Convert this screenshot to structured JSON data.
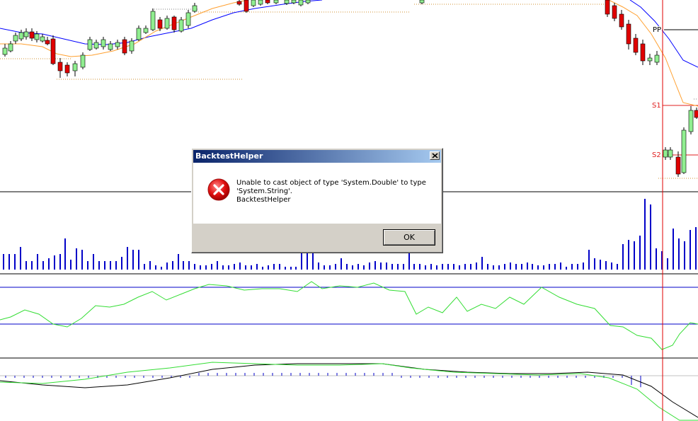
{
  "chart": {
    "pivot_labels": {
      "pp": "PP",
      "s1": "S1",
      "s2": "S2"
    },
    "colors": {
      "bull": "#90ee90",
      "bear": "#e00000",
      "ma_fast": "#ffa030",
      "ma_slow": "#0000ff",
      "volume": "#0000c8",
      "rsi": "#33dd33",
      "macd_signal": "#33dd33",
      "macd_line": "#000000",
      "pivot_pp": "#000000",
      "pivot_s": "#e02020",
      "cursor": "#e00000"
    }
  },
  "dialog": {
    "title": "BacktestHelper",
    "message_line1": "Unable to cast object of type 'System.Double' to type 'System.String'.",
    "message_line2": "BacktestHelper",
    "ok_label": "OK",
    "icon": "error-icon"
  }
}
